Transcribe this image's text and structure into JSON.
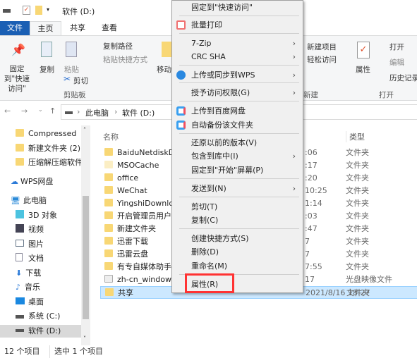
{
  "title": "软件 (D:)",
  "tabs": [
    {
      "label": "文件"
    },
    {
      "label": "主页"
    },
    {
      "label": "共享"
    },
    {
      "label": "查看"
    }
  ],
  "ribbon": {
    "pin": "固定到\"快速访问\"",
    "copy": "复制",
    "paste": "粘贴",
    "copy_path": "复制路径",
    "paste_shortcut": "粘贴快捷方式",
    "cut": "剪切",
    "clipboard_group": "剪贴板",
    "move": "移动",
    "new_item": "新建项目",
    "easy_access": "轻松访问",
    "new_group": "新建",
    "properties": "属性",
    "open": "打开",
    "edit": "编辑",
    "history": "历史记录",
    "open_group": "打开"
  },
  "breadcrumb": [
    "此电脑",
    "软件 (D:)"
  ],
  "nav": [
    {
      "label": "Compressed"
    },
    {
      "label": "新建文件夹 (2)"
    },
    {
      "label": "压缩解压缩软件"
    },
    {
      "label": "WPS网盘"
    },
    {
      "label": "此电脑"
    },
    {
      "label": "3D 对象"
    },
    {
      "label": "视频"
    },
    {
      "label": "图片"
    },
    {
      "label": "文档"
    },
    {
      "label": "下载"
    },
    {
      "label": "音乐"
    },
    {
      "label": "桌面"
    },
    {
      "label": "系统 (C:)"
    },
    {
      "label": "软件 (D:)"
    }
  ],
  "columns": {
    "name": "名称",
    "type": "类型"
  },
  "files": [
    {
      "name": "BaiduNetdiskDo",
      "date": ":06",
      "type": "文件夹"
    },
    {
      "name": "MSOCache",
      "date": ":17",
      "type": "文件夹"
    },
    {
      "name": "office",
      "date": ":20",
      "type": "文件夹"
    },
    {
      "name": "WeChat",
      "date": "10:25",
      "type": "文件夹"
    },
    {
      "name": "YingshiDownloa",
      "date": "1:14",
      "type": "文件夹"
    },
    {
      "name": "开启管理员用户",
      "date": ":03",
      "type": "文件夹"
    },
    {
      "name": "新建文件夹",
      "date": ":47",
      "type": "文件夹"
    },
    {
      "name": "迅雷下载",
      "date": "7",
      "type": "文件夹"
    },
    {
      "name": "迅雷云盘",
      "date": "7",
      "type": "文件夹"
    },
    {
      "name": "有专自媒体助手",
      "date": "7:55",
      "type": "文件夹"
    },
    {
      "name": "zh-cn_windows_",
      "date": "17",
      "type": "光盘映像文件"
    },
    {
      "name": "共享",
      "date": "2021/8/16 18:27",
      "type": "文件夹"
    }
  ],
  "menu": [
    {
      "label": "固定到\"快速访问\""
    },
    {
      "label": "批量打印",
      "icon": "printer-icon"
    },
    {
      "label": "7-Zip",
      "sub": true
    },
    {
      "label": "CRC SHA",
      "sub": true
    },
    {
      "label": "上传或同步到WPS",
      "sub": true,
      "icon": "cloud-upload-icon"
    },
    {
      "label": "授予访问权限(G)",
      "sub": true
    },
    {
      "label": "上传到百度网盘",
      "icon": "baidu-netdisk-icon"
    },
    {
      "label": "自动备份该文件夹",
      "icon": "baidu-netdisk-icon"
    },
    {
      "label": "还原以前的版本(V)"
    },
    {
      "label": "包含到库中(I)",
      "sub": true
    },
    {
      "label": "固定到\"开始\"屏幕(P)"
    },
    {
      "label": "发送到(N)",
      "sub": true
    },
    {
      "label": "剪切(T)"
    },
    {
      "label": "复制(C)"
    },
    {
      "label": "创建快捷方式(S)"
    },
    {
      "label": "删除(D)"
    },
    {
      "label": "重命名(M)"
    },
    {
      "label": "属性(R)"
    }
  ],
  "arrow": "›",
  "status": {
    "count": "12 个项目",
    "selected": "选中 1 个项目"
  },
  "colors": {
    "file_tab": "#1a5fb4",
    "highlight_box": "#ff3333",
    "selection": "#cce8ff"
  }
}
